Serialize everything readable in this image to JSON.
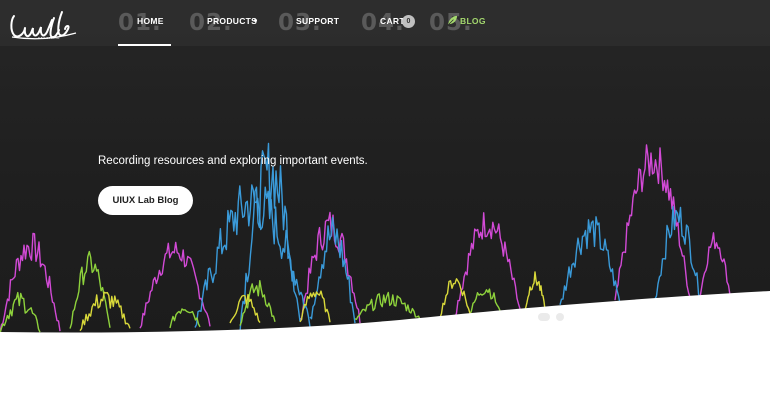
{
  "brand": {
    "logo_text": "UIUX Lab"
  },
  "nav": {
    "items": [
      {
        "num": "01.",
        "label": "HOME"
      },
      {
        "num": "02.",
        "label": "PRODUCTS"
      },
      {
        "num": "03.",
        "label": "SUPPORT"
      },
      {
        "num": "04.",
        "label": "CART"
      },
      {
        "num": "05.",
        "label": "BLOG"
      }
    ],
    "cart_count": "0",
    "active": "HOME"
  },
  "hero": {
    "tagline": "Recording resources and exploring important events.",
    "cta_label": "UIUX Lab Blog"
  },
  "colors": {
    "accent_blog": "#a4d86e",
    "wave_magenta": "#d24ad6",
    "wave_blue": "#3a9ad9",
    "wave_green": "#8ed23c",
    "wave_yellow": "#d9d93a"
  },
  "slider": {
    "dots": 2,
    "active_index": 0
  }
}
